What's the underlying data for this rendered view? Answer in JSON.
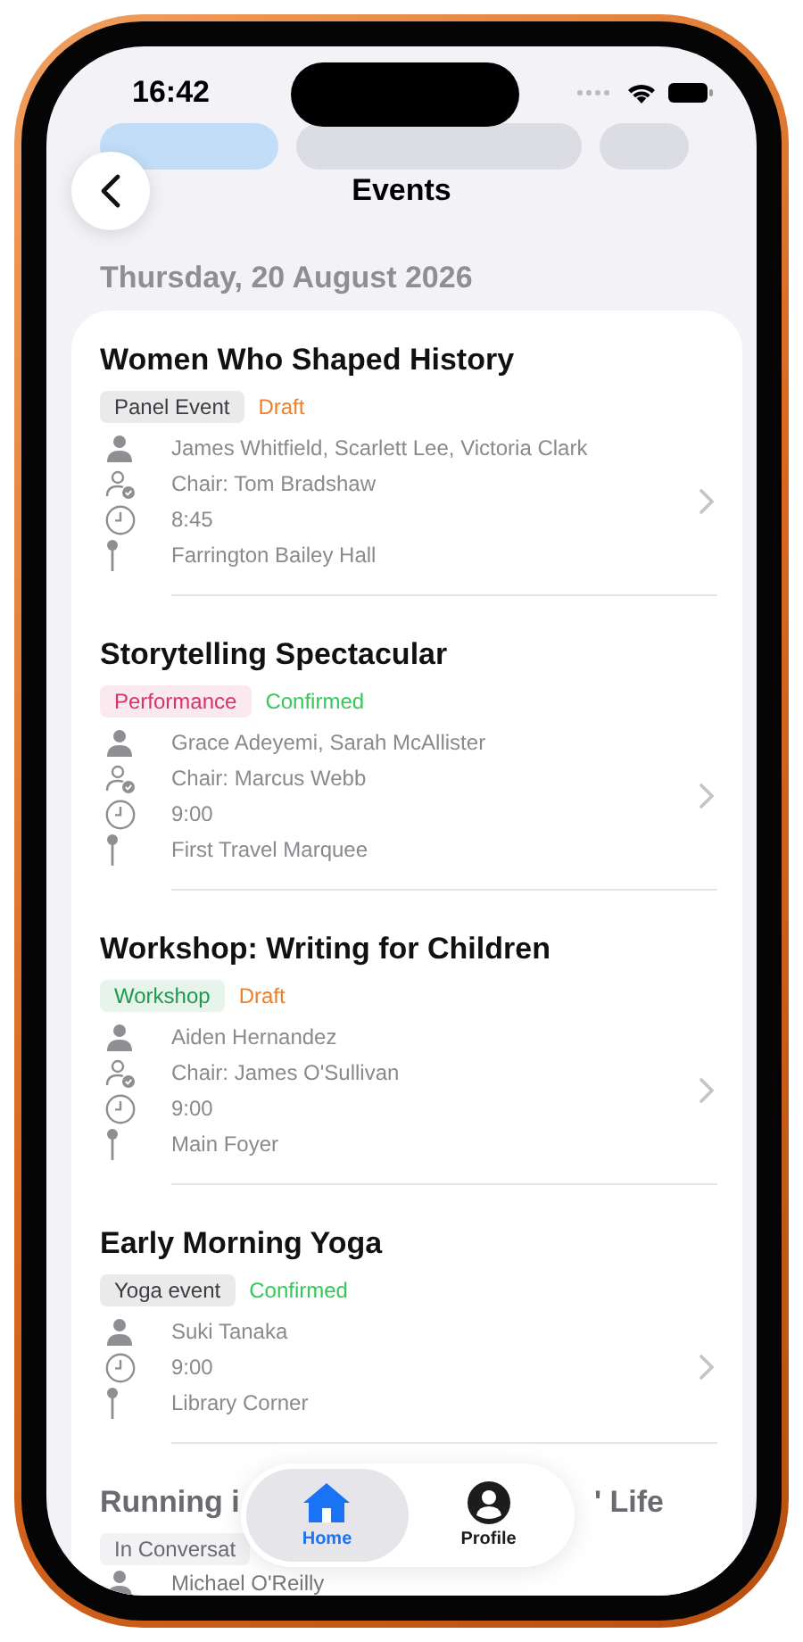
{
  "status_bar": {
    "time": "16:42"
  },
  "nav": {
    "title": "Events"
  },
  "date_header": "Thursday, 20 August 2026",
  "events": [
    {
      "title": "Women Who Shaped History",
      "category": {
        "label": "Panel Event",
        "color": "#3c3c43"
      },
      "status": {
        "kind": "draft",
        "label": "Draft"
      },
      "details": [
        {
          "kind": "speakers",
          "text": "James Whitfield, Scarlett Lee, Victoria Clark"
        },
        {
          "kind": "chair",
          "text": "Chair: Tom Bradshaw"
        },
        {
          "kind": "time",
          "text": "8:45"
        },
        {
          "kind": "venue",
          "text": "Farrington Bailey Hall"
        }
      ]
    },
    {
      "title": "Storytelling Spectacular",
      "category": {
        "label": "Performance",
        "color": "#d6336c"
      },
      "status": {
        "kind": "confirmed",
        "label": "Confirmed"
      },
      "details": [
        {
          "kind": "speakers",
          "text": "Grace Adeyemi, Sarah McAllister"
        },
        {
          "kind": "chair",
          "text": "Chair: Marcus Webb"
        },
        {
          "kind": "time",
          "text": "9:00"
        },
        {
          "kind": "venue",
          "text": "First Travel Marquee"
        }
      ]
    },
    {
      "title": "Workshop: Writing for Children",
      "category": {
        "label": "Workshop",
        "color": "#1f9a4d"
      },
      "status": {
        "kind": "draft",
        "label": "Draft"
      },
      "details": [
        {
          "kind": "speakers",
          "text": "Aiden Hernandez"
        },
        {
          "kind": "chair",
          "text": "Chair: James O'Sullivan"
        },
        {
          "kind": "time",
          "text": "9:00"
        },
        {
          "kind": "venue",
          "text": "Main Foyer"
        }
      ]
    },
    {
      "title": "Early Morning Yoga",
      "category": {
        "label": "Yoga event",
        "color": "#3c3c43"
      },
      "status": {
        "kind": "confirmed",
        "label": "Confirmed"
      },
      "details": [
        {
          "kind": "speakers",
          "text": "Suki Tanaka"
        },
        {
          "kind": "time",
          "text": "9:00"
        },
        {
          "kind": "venue",
          "text": "Library Corner"
        }
      ]
    }
  ],
  "partial_event": {
    "title_start": "Running i",
    "title_end": "' Life",
    "category": "In Conversat",
    "speaker": "Michael O'Reilly"
  },
  "tab_bar": [
    {
      "label": "Home",
      "kind": "home",
      "selected": true
    },
    {
      "label": "Profile",
      "kind": "profile",
      "selected": false
    }
  ]
}
